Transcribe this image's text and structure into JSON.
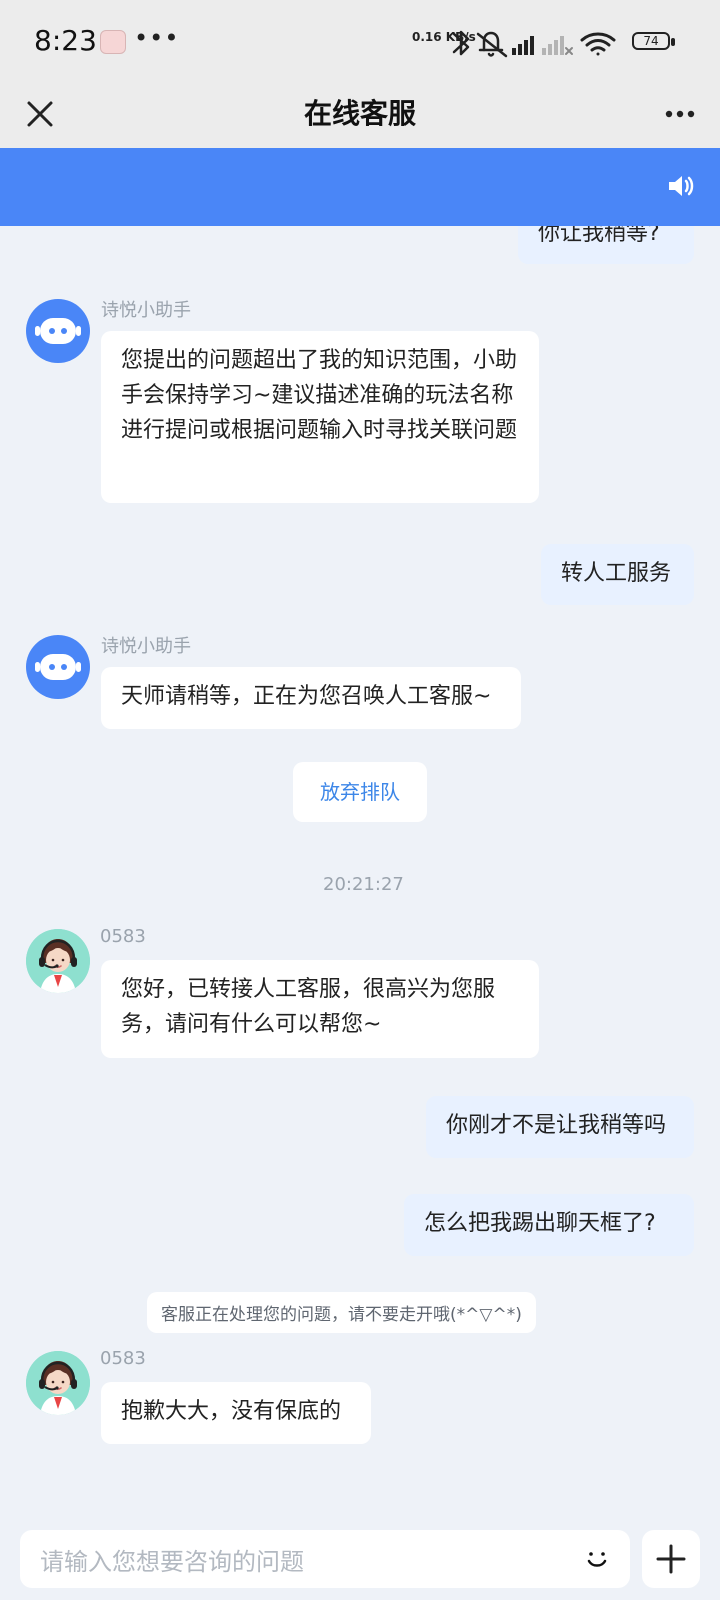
{
  "status_bar": {
    "time": "8:23",
    "more": "•••",
    "network_speed": "0.16 KB/s",
    "battery": "74"
  },
  "header": {
    "title": "在线客服",
    "close_icon": "close-icon",
    "more_icon": "more-icon"
  },
  "banner": {
    "accent_color": "#4a86f7",
    "speaker_icon": "speaker-icon"
  },
  "chat": {
    "messages": [
      {
        "role": "user",
        "text": "你让我稍等?"
      },
      {
        "role": "bot",
        "sender": "诗悦小助手",
        "text": "您提出的问题超出了我的知识范围，小助手会保持学习~建议描述准确的玩法名称进行提问或根据问题输入时寻找关联问题"
      },
      {
        "role": "user",
        "text": "转人工服务"
      },
      {
        "role": "bot",
        "sender": "诗悦小助手",
        "text": "天师请稍等，正在为您召唤人工客服~"
      },
      {
        "role": "action",
        "text": "放弃排队"
      },
      {
        "role": "timestamp",
        "text": "20:21:27"
      },
      {
        "role": "agent",
        "sender": "0583",
        "text": "您好，已转接人工客服，很高兴为您服务，请问有什么可以帮您~"
      },
      {
        "role": "user",
        "text": "你刚才不是让我稍等吗"
      },
      {
        "role": "user",
        "text": "怎么把我踢出聊天框了?"
      },
      {
        "role": "system",
        "text": "客服正在处理您的问题，请不要走开哦(*^▽^*)"
      },
      {
        "role": "agent",
        "sender": "0583",
        "text": "抱歉大大，没有保底的"
      }
    ]
  },
  "composer": {
    "placeholder": "请输入您想要咨询的问题",
    "emoji_icon": "emoji-icon",
    "plus_icon": "plus-icon"
  }
}
